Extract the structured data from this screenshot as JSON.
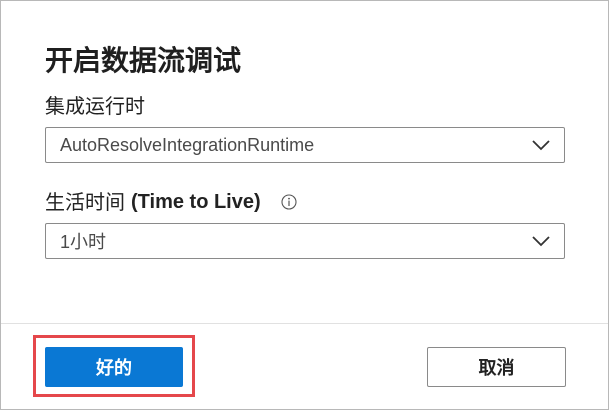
{
  "dialog": {
    "title": "开启数据流调试"
  },
  "runtime_field": {
    "label": "集成运行时",
    "value": "AutoResolveIntegrationRuntime"
  },
  "ttl_field": {
    "label_zh": "生活时间",
    "label_en": "(Time to Live)",
    "value": "1小时"
  },
  "icons": {
    "info": "info-icon",
    "dropdown": "chevron-down-icon"
  },
  "footer": {
    "ok_label": "好的",
    "cancel_label": "取消"
  },
  "colors": {
    "primary": "#0a78d4",
    "highlight": "#e5474b",
    "border": "#8a8a8a"
  }
}
